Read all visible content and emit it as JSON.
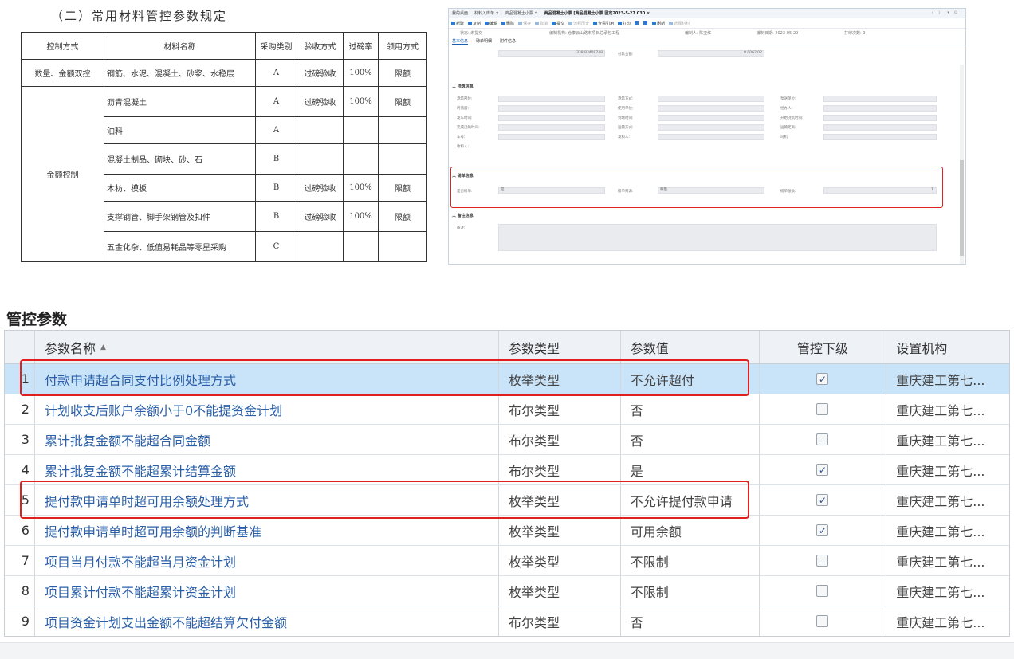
{
  "doc": {
    "title": "（二）常用材料管控参数规定",
    "headers": [
      "控制方式",
      "材料名称",
      "采购类别",
      "验收方式",
      "过磅率",
      "领用方式"
    ],
    "group1": {
      "control": "数量、金额双控",
      "material": "钢筋、水泥、混凝土、砂浆、水稳层",
      "category": "A",
      "acceptance": "过磅验收",
      "rate": "100%",
      "usage": "限额"
    },
    "group2_control": "金额控制",
    "group2_rows": [
      {
        "material": "沥青混凝土",
        "category": "A",
        "acceptance": "过磅验收",
        "rate": "100%",
        "usage": "限额"
      },
      {
        "material": "油料",
        "category": "A",
        "acceptance": "",
        "rate": "",
        "usage": ""
      },
      {
        "material": "混凝土制品、砌块、砂、石",
        "category": "B",
        "acceptance": "",
        "rate": "",
        "usage": ""
      },
      {
        "material": "木枋、模板",
        "category": "B",
        "acceptance": "过磅验收",
        "rate": "100%",
        "usage": "限额"
      },
      {
        "material": "支撑钢管、脚手架钢管及扣件",
        "category": "B",
        "acceptance": "过磅验收",
        "rate": "100%",
        "usage": "限额"
      },
      {
        "material": "五金化杂、低值易耗品等零星采购",
        "category": "C",
        "acceptance": "",
        "rate": "",
        "usage": ""
      }
    ]
  },
  "shot": {
    "tabs": [
      "我的桌面",
      "材料入库单 ×",
      "商品混凝土小票 ×",
      "商品混凝土小票 [商品混凝土小票 固定2023-5-27 C30 ×"
    ],
    "right_ctrls": [
      "〈",
      "〉",
      "▾",
      "⊙"
    ],
    "toolbar": [
      "新建",
      "复制",
      "编辑",
      "删除",
      "保存",
      "取消",
      "提交",
      "流程历史",
      "查看引用",
      "打印",
      "",
      "",
      "刷新",
      "选择材料"
    ],
    "status": {
      "state": "状态: 未提交",
      "org": "编制机构: 仓泰云山路市项目总承包工程",
      "maker": "编制人: 陈亚红",
      "date": "编制日期: 2023-05-29",
      "prints": "打印次数: 0"
    },
    "subtabs": [
      "基本信息",
      "磅单明细",
      "附件信息"
    ],
    "top_values": [
      "338.83409748",
      "付款金额:",
      "0.0062.02"
    ],
    "sec_pour": "浇筑信息",
    "pour_labels_c1": [
      "浇筑部位:",
      "坍落度:",
      "发车时间:",
      "完成浇筑时间:",
      "车号:",
      "收料人:"
    ],
    "pour_labels_c2": [
      "浇筑方式:",
      "使用单位:",
      "到场时间:",
      "运输方式:",
      "发料人:"
    ],
    "pour_labels_c3": [
      "泵送单位:",
      "经办人:",
      "开始浇筑时间:",
      "运输距离:",
      "司机:"
    ],
    "sec_weigh": "磅单信息",
    "weigh_labels": [
      "是否磅单:",
      "磅单来源:",
      "磅单张数:"
    ],
    "weigh_values": [
      "是",
      "称量",
      "1"
    ],
    "sec_note": "备注信息",
    "note_label": "备注:"
  },
  "grid": {
    "title": "管控参数",
    "headers": {
      "name": "参数名称",
      "type": "参数类型",
      "value": "参数值",
      "sub": "管控下级",
      "org": "设置机构"
    },
    "rows": [
      {
        "idx": "1",
        "name": "付款申请超合同支付比例处理方式",
        "type": "枚举类型",
        "value": "不允许超付",
        "checked": true,
        "org": "重庆建工第七..."
      },
      {
        "idx": "2",
        "name": "计划收支后账户余额小于0不能提资金计划",
        "type": "布尔类型",
        "value": "否",
        "checked": false,
        "org": "重庆建工第七..."
      },
      {
        "idx": "3",
        "name": "累计批复金额不能超合同金额",
        "type": "布尔类型",
        "value": "否",
        "checked": false,
        "org": "重庆建工第七..."
      },
      {
        "idx": "4",
        "name": "累计批复金额不能超累计结算金额",
        "type": "布尔类型",
        "value": "是",
        "checked": true,
        "org": "重庆建工第七..."
      },
      {
        "idx": "5",
        "name": "提付款申请单时超可用余额处理方式",
        "type": "枚举类型",
        "value": "不允许提付款申请",
        "checked": true,
        "org": "重庆建工第七..."
      },
      {
        "idx": "6",
        "name": "提付款申请单时超可用余额的判断基准",
        "type": "枚举类型",
        "value": "可用余额",
        "checked": true,
        "org": "重庆建工第七..."
      },
      {
        "idx": "7",
        "name": "项目当月付款不能超当月资金计划",
        "type": "枚举类型",
        "value": "不限制",
        "checked": false,
        "org": "重庆建工第七..."
      },
      {
        "idx": "8",
        "name": "项目累计付款不能超累计资金计划",
        "type": "枚举类型",
        "value": "不限制",
        "checked": false,
        "org": "重庆建工第七..."
      },
      {
        "idx": "9",
        "name": "项目资金计划支出金额不能超结算欠付金额",
        "type": "布尔类型",
        "value": "否",
        "checked": false,
        "org": "重庆建工第七..."
      }
    ]
  }
}
